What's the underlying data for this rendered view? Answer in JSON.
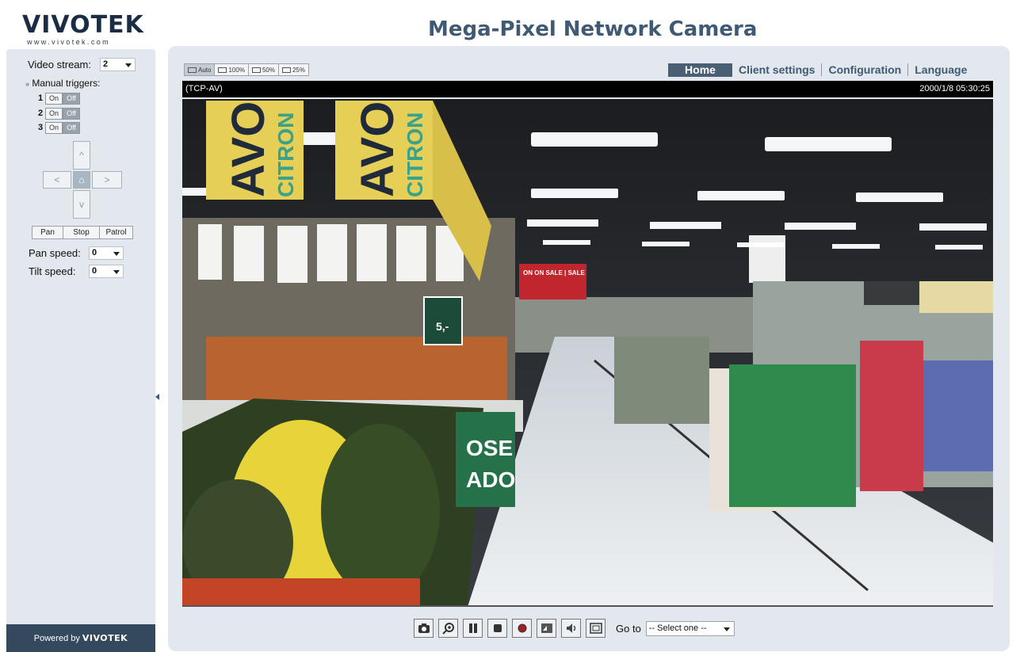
{
  "logo": {
    "brand": "VIVOTEK",
    "url_text": "www.vivotek.com"
  },
  "page_title": "Mega-Pixel Network Camera",
  "left_panel": {
    "video_stream_label": "Video stream:",
    "video_stream_value": "2",
    "manual_triggers_label": "Manual triggers:",
    "triggers": [
      {
        "num": "1",
        "on": "On",
        "off": "Off"
      },
      {
        "num": "2",
        "on": "On",
        "off": "Off"
      },
      {
        "num": "3",
        "on": "On",
        "off": "Off"
      }
    ],
    "ptz_buttons": {
      "pan": "Pan",
      "stop": "Stop",
      "patrol": "Patrol"
    },
    "pan_speed_label": "Pan speed:",
    "pan_speed_value": "0",
    "tilt_speed_label": "Tilt speed:",
    "tilt_speed_value": "0",
    "powered_by": "Powered by",
    "powered_brand": "VIVOTEK"
  },
  "size_buttons": [
    "Auto",
    "100%",
    "50%",
    "25%"
  ],
  "nav": {
    "home": "Home",
    "client_settings": "Client settings",
    "configuration": "Configuration",
    "language": "Language"
  },
  "video": {
    "protocol": "(TCP-AV)",
    "timestamp": "2000/1/8 05:30:25",
    "signs": {
      "avoc_1": "AVOC",
      "citron_1": "CITRON",
      "avoc_2": "AVOC",
      "citron_2": "CITRON",
      "sale": "ON ON SALE | SALE",
      "ose": "OSE",
      "ado": "ADO",
      "price": "5,-"
    }
  },
  "toolbar": {
    "icons": [
      "camera-icon",
      "zoom-icon",
      "pause-icon",
      "stop-icon",
      "record-icon",
      "volume-icon",
      "speaker-icon",
      "fullscreen-icon"
    ],
    "goto_label": "Go to",
    "goto_value": "-- Select one --"
  },
  "colors": {
    "panel": "#e2e8ee",
    "title": "#3f5a74",
    "nav_active": "#4a5f74",
    "footer": "#34495e"
  }
}
